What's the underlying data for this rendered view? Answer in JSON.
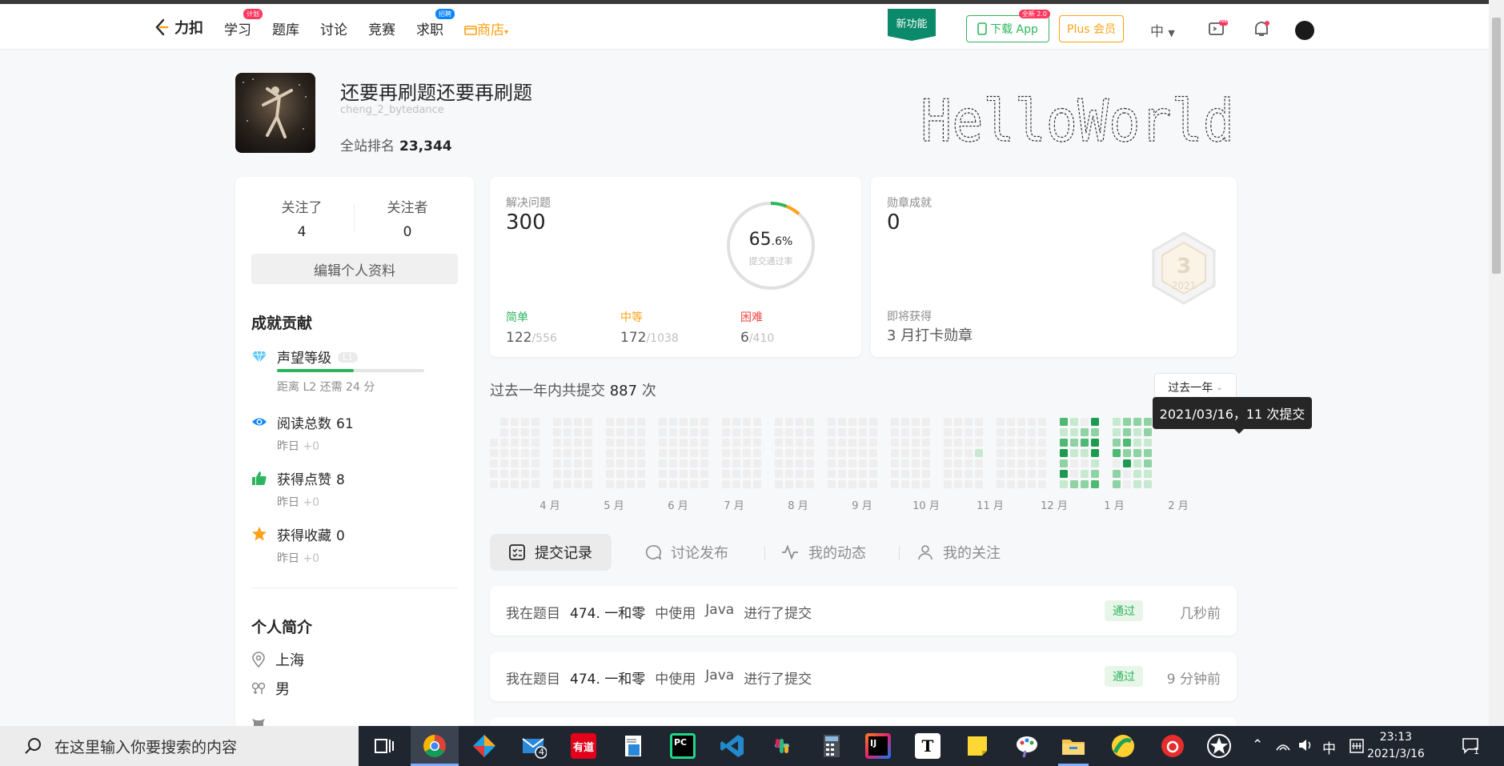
{
  "nav": {
    "logo_text": "力扣",
    "items": [
      {
        "label": "学习",
        "badge": "计划",
        "badge_color": "#ff375f"
      },
      {
        "label": "题库",
        "badge": ""
      },
      {
        "label": "讨论",
        "badge": ""
      },
      {
        "label": "竞赛",
        "badge": ""
      },
      {
        "label": "求职",
        "badge": "招聘",
        "badge_color": "#0a84ff"
      },
      {
        "label": "商店",
        "badge": ""
      }
    ],
    "new_feature": "新功能",
    "download_label": "下载 App",
    "download_tag": "全新 2.0",
    "plus_label": "Plus 会员",
    "lang": "中",
    "notif_tag": "NEW"
  },
  "profile": {
    "username": "还要再刷题还要再刷题",
    "handle": "cheng_2_bytedance",
    "rank_label": "全站排名",
    "rank_value": "23,344"
  },
  "follow": {
    "following_label": "关注了",
    "following": "4",
    "followers_label": "关注者",
    "followers": "0",
    "edit_label": "编辑个人资料"
  },
  "achievements": {
    "title": "成就贡献",
    "items": [
      {
        "name": "声望等级",
        "value": "",
        "tag": "L1",
        "sub": "距离 L2 还需 24 分",
        "progress": 0.52
      },
      {
        "name": "阅读总数",
        "value": "61",
        "sub_label": "昨日",
        "sub_delta": "+0"
      },
      {
        "name": "获得点赞",
        "value": "8",
        "sub_label": "昨日",
        "sub_delta": "+0"
      },
      {
        "name": "获得收藏",
        "value": "0",
        "sub_label": "昨日",
        "sub_delta": "+0"
      }
    ]
  },
  "bio": {
    "title": "个人简介",
    "location": "上海",
    "gender": "男"
  },
  "solved": {
    "label": "解决问题",
    "count": "300",
    "rate_int": "65",
    "rate_dec": ".6%",
    "rate_label": "提交通过率",
    "rate_fraction": 0.656,
    "easy_label": "简单",
    "easy": "122",
    "easy_total": "/556",
    "medium_label": "中等",
    "medium": "172",
    "medium_total": "/1038",
    "hard_label": "困难",
    "hard": "6",
    "hard_total": "/410",
    "colors": {
      "easy": "#2db55d",
      "medium": "#ffa116",
      "hard": "#ef4743"
    }
  },
  "badges": {
    "label": "勋章成就",
    "count": "0",
    "upcoming_label": "即将获得",
    "upcoming_name": "3 月打卡勋章",
    "badge_number": "3",
    "badge_year": "2021"
  },
  "submissions": {
    "prefix": "过去一年内共提交",
    "count": "887",
    "suffix": "次",
    "range_select": "过去一年",
    "tooltip": "2021/03/16，11 次提交",
    "months": [
      "4 月",
      "5 月",
      "6 月",
      "7 月",
      "8 月",
      "9 月",
      "10 月",
      "11 月",
      "12 月",
      "1 月",
      "2 月"
    ]
  },
  "ascii_art": "HelloWorld",
  "tabs": [
    {
      "label": "提交记录",
      "icon": "list-icon"
    },
    {
      "label": "讨论发布",
      "icon": "chat-icon"
    },
    {
      "label": "我的动态",
      "icon": "activity-icon"
    },
    {
      "label": "我的关注",
      "icon": "user-icon"
    }
  ],
  "records": [
    {
      "prefix": "我在题目",
      "problem": "474. 一和零",
      "mid": "中使用",
      "lang": "Java",
      "suffix": "进行了提交",
      "status": "通过",
      "time": "几秒前"
    },
    {
      "prefix": "我在题目",
      "problem": "474. 一和零",
      "mid": "中使用",
      "lang": "Java",
      "suffix": "进行了提交",
      "status": "通过",
      "time": "9 分钟前"
    }
  ],
  "taskbar": {
    "search_placeholder": "在这里输入你要搜索的内容",
    "mail_count": "4",
    "ime": "中",
    "time": "23:13",
    "date": "2021/3/16",
    "notif_count": "1"
  }
}
